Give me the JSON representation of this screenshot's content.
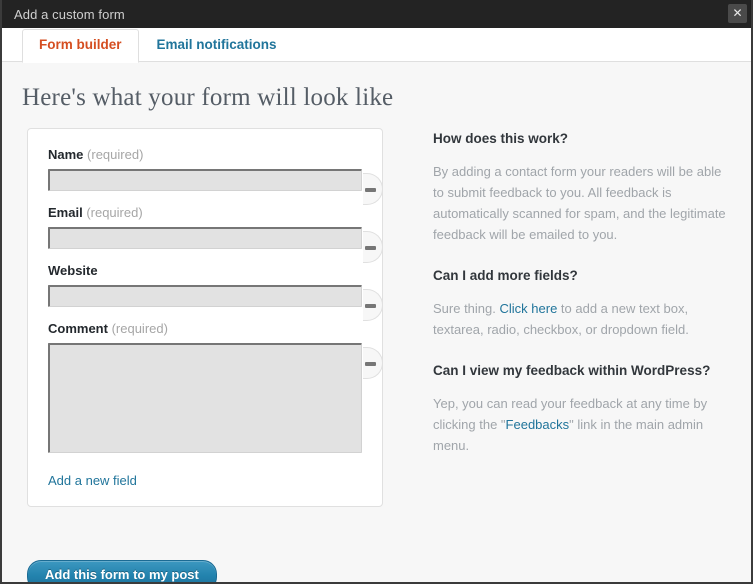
{
  "window": {
    "title": "Add a custom form",
    "close_label": "✕"
  },
  "tabs": [
    {
      "label": "Form builder",
      "active": true
    },
    {
      "label": "Email notifications",
      "active": false
    }
  ],
  "main": {
    "heading": "Here's what your form will look like",
    "add_field_link": "Add a new field",
    "submit_label": "Add this form to my post",
    "remove_icon": "minus-icon"
  },
  "form_fields": [
    {
      "label": "Name",
      "required_suffix": "(required)",
      "type": "text"
    },
    {
      "label": "Email",
      "required_suffix": "(required)",
      "type": "text"
    },
    {
      "label": "Website",
      "required_suffix": "",
      "type": "text"
    },
    {
      "label": "Comment",
      "required_suffix": "(required)",
      "type": "textarea"
    }
  ],
  "faq": [
    {
      "question": "How does this work?",
      "answer_parts": [
        {
          "text": "By adding a contact form your readers will be able to submit feedback to you. All feedback is automatically scanned for spam, and the legitimate feedback will be emailed to you.",
          "link": false
        }
      ]
    },
    {
      "question": "Can I add more fields?",
      "answer_parts": [
        {
          "text": "Sure thing. ",
          "link": false
        },
        {
          "text": "Click here",
          "link": true
        },
        {
          "text": " to add a new text box, textarea, radio, checkbox, or dropdown field.",
          "link": false
        }
      ]
    },
    {
      "question": "Can I view my feedback within WordPress?",
      "answer_parts": [
        {
          "text": "Yep, you can read your feedback at any time by clicking the \"",
          "link": false
        },
        {
          "text": "Feedbacks",
          "link": true
        },
        {
          "text": "\" link in the main admin menu.",
          "link": false
        }
      ]
    }
  ],
  "colors": {
    "titlebar_bg": "#232323",
    "active_tab_text": "#d54e21",
    "link": "#21759b",
    "button_blue": "#2383ae",
    "muted_text": "#a0a5aa"
  }
}
